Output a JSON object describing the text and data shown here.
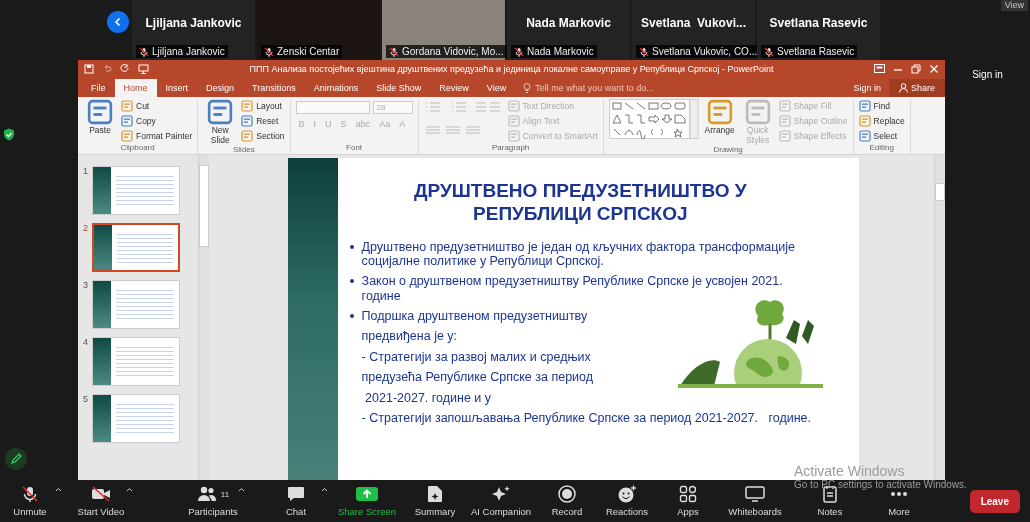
{
  "meeting": {
    "view_button": "View",
    "participants": [
      {
        "kind": "name",
        "name": "Ljiljana Jankovic",
        "label": "Ljiljana Jankovic"
      },
      {
        "kind": "dark",
        "label": "Zenski Centar"
      },
      {
        "kind": "video",
        "label": "Gordana Vidovic, Mo..."
      },
      {
        "kind": "name",
        "name": "Nada Markovic",
        "label": "Nada Markovic"
      },
      {
        "kind": "name",
        "name": "Svetlana  Vukovi...",
        "label": "Svetlana Vukovic, CO..."
      },
      {
        "kind": "name",
        "name": "Svetlana Rasevic",
        "label": "Svetlana Rasevic"
      }
    ],
    "sign_in": "Sign in"
  },
  "window": {
    "title": "ППП Анализа постојећих вјештина друштвених предузећа и јединица локалне самоуправе у Републици Српској - PowerPoint",
    "tabs": [
      {
        "label": "File",
        "selected": false
      },
      {
        "label": "Home",
        "selected": true
      },
      {
        "label": "Insert",
        "selected": false
      },
      {
        "label": "Design",
        "selected": false
      },
      {
        "label": "Transitions",
        "selected": false
      },
      {
        "label": "Animations",
        "selected": false
      },
      {
        "label": "Slide Show",
        "selected": false
      },
      {
        "label": "Review",
        "selected": false
      },
      {
        "label": "View",
        "selected": false
      }
    ],
    "tell_me": {
      "placeholder": "Tell me what you want to do..."
    },
    "sign_in": "Sign in",
    "share": "Share"
  },
  "ribbon": {
    "groups": [
      {
        "kind": "plain",
        "label": "Clipboard",
        "items": [
          {
            "kind": "large",
            "label": "Paste",
            "disabled": false
          },
          {
            "kind": "small",
            "label": "Cut",
            "disabled": false
          },
          {
            "kind": "small",
            "label": "Copy",
            "disabled": false
          },
          {
            "kind": "small",
            "label": "Format Painter",
            "disabled": false
          }
        ]
      },
      {
        "kind": "plain",
        "label": "Slides",
        "items": [
          {
            "kind": "large",
            "label": "New Slide",
            "disabled": false
          },
          {
            "kind": "small",
            "label": "Layout",
            "disabled": false
          },
          {
            "kind": "small",
            "label": "Reset",
            "disabled": false
          },
          {
            "kind": "small",
            "label": "Section",
            "disabled": false
          }
        ]
      },
      {
        "kind": "font",
        "label": "Font",
        "items": [
          {
            "kind": "field",
            "disabled": true
          },
          {
            "kind": "field",
            "label": "28",
            "disabled": true
          },
          {
            "kind": "glyph",
            "label": "B",
            "disabled": true
          },
          {
            "kind": "glyph",
            "label": "I",
            "disabled": true
          },
          {
            "kind": "glyph",
            "label": "U",
            "disabled": true
          },
          {
            "kind": "glyph",
            "label": "S",
            "disabled": true
          },
          {
            "kind": "glyph",
            "label": "abc",
            "disabled": true
          },
          {
            "kind": "glyph",
            "label": "Aa",
            "disabled": true
          },
          {
            "kind": "glyph",
            "label": "A",
            "disabled": true
          }
        ]
      },
      {
        "kind": "paragraph",
        "label": "Paragraph",
        "items": [
          {
            "kind": "small",
            "label": "Text Direction",
            "disabled": true
          },
          {
            "kind": "small",
            "label": "Align Text",
            "disabled": true
          },
          {
            "kind": "small",
            "label": "Convert to SmartArt",
            "disabled": true
          }
        ]
      },
      {
        "kind": "drawing",
        "label": "Drawing",
        "items": [
          {
            "kind": "large",
            "label": "Arrange",
            "disabled": false
          },
          {
            "kind": "large",
            "label": "Quick Styles",
            "disabled": true
          },
          {
            "kind": "small",
            "label": "Shape Fill",
            "disabled": true
          },
          {
            "kind": "small",
            "label": "Shape Outline",
            "disabled": true
          },
          {
            "kind": "small",
            "label": "Shape Effects",
            "disabled": true
          }
        ]
      },
      {
        "kind": "plain",
        "label": "Editing",
        "items": [
          {
            "kind": "small",
            "label": "Find",
            "disabled": false
          },
          {
            "kind": "small",
            "label": "Replace",
            "disabled": false
          },
          {
            "kind": "small",
            "label": "Select",
            "disabled": false
          }
        ]
      }
    ]
  },
  "thumbnails": [
    {
      "number": "1",
      "selected": false
    },
    {
      "number": "2",
      "selected": true
    },
    {
      "number": "3",
      "selected": false
    },
    {
      "number": "4",
      "selected": false
    },
    {
      "number": "5",
      "selected": false
    }
  ],
  "slide": {
    "title": "ДРУШТВЕНО ПРЕДУЗЕТНИШТВО У РЕПУБЛИЦИ СРПСКОЈ",
    "lines": [
      {
        "kind": "bullet",
        "text": "Друштвено предузетништво је један од кључних фактора трансформације социјалне политике у Републици Српској."
      },
      {
        "kind": "bullet",
        "text": "Закон о друштвеном предузетништву Републике Српске је усвојен 2021. године"
      },
      {
        "kind": "bullet",
        "text": "Подршка друштвеном предузетништву"
      },
      {
        "kind": "line",
        "text": "предвиђена је у:"
      },
      {
        "kind": "line",
        "text": "- Стратегији за развој малих и средњих"
      },
      {
        "kind": "line",
        "text": "предузећа Републике Српске за период"
      },
      {
        "kind": "line",
        "text": " 2021-2027. године и у"
      },
      {
        "kind": "wide",
        "text": "- Стратегији запошљавања Републике Српске за период 2021-2027.   године."
      }
    ]
  },
  "os_notice": {
    "title": "Activate Windows",
    "text": "Go to PC settings to activate Windows."
  },
  "toolbar": {
    "items": [
      {
        "kind": "mic",
        "label": "Unmute",
        "caret": true
      },
      {
        "kind": "video",
        "label": "Start Video",
        "caret": true
      },
      {
        "kind": "people",
        "label": "Participants",
        "count": "11",
        "caret": true
      },
      {
        "kind": "chat",
        "label": "Chat",
        "caret": true
      },
      {
        "kind": "share",
        "label": "Share Screen",
        "caret": false
      },
      {
        "kind": "summary",
        "label": "Summary",
        "caret": false
      },
      {
        "kind": "ai",
        "label": "AI Companion",
        "caret": false
      },
      {
        "kind": "record",
        "label": "Record",
        "caret": false
      },
      {
        "kind": "reactions",
        "label": "Reactions",
        "caret": false
      },
      {
        "kind": "apps",
        "label": "Apps",
        "caret": false
      },
      {
        "kind": "board",
        "label": "Whiteboards",
        "caret": false
      },
      {
        "kind": "notes",
        "label": "Notes",
        "caret": false
      },
      {
        "kind": "more",
        "label": "More",
        "caret": false
      }
    ],
    "leave": "Leave"
  }
}
